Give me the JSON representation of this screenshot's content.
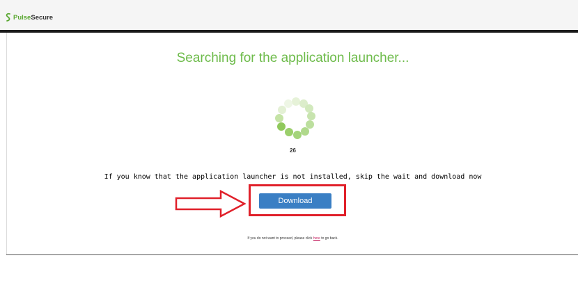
{
  "header": {
    "logo_pulse": "Pulse",
    "logo_secure": "Secure"
  },
  "main": {
    "title": "Searching for the application launcher...",
    "countdown": "26",
    "skip_text": "If you know that the application launcher is not installed, skip the wait and download now",
    "download_label": "Download",
    "back_prefix": "If you do not want to proceed, please click ",
    "back_link": "here",
    "back_suffix": " to go back."
  },
  "colors": {
    "brand_green": "#6dbb4a",
    "button_blue": "#3a7fc4",
    "highlight_red": "#e0202a",
    "link_pink": "#c2185b"
  },
  "icons": {
    "logo": "pulse-secure-logo-icon",
    "spinner": "loading-spinner-icon",
    "arrow": "red-outline-arrow-icon"
  }
}
